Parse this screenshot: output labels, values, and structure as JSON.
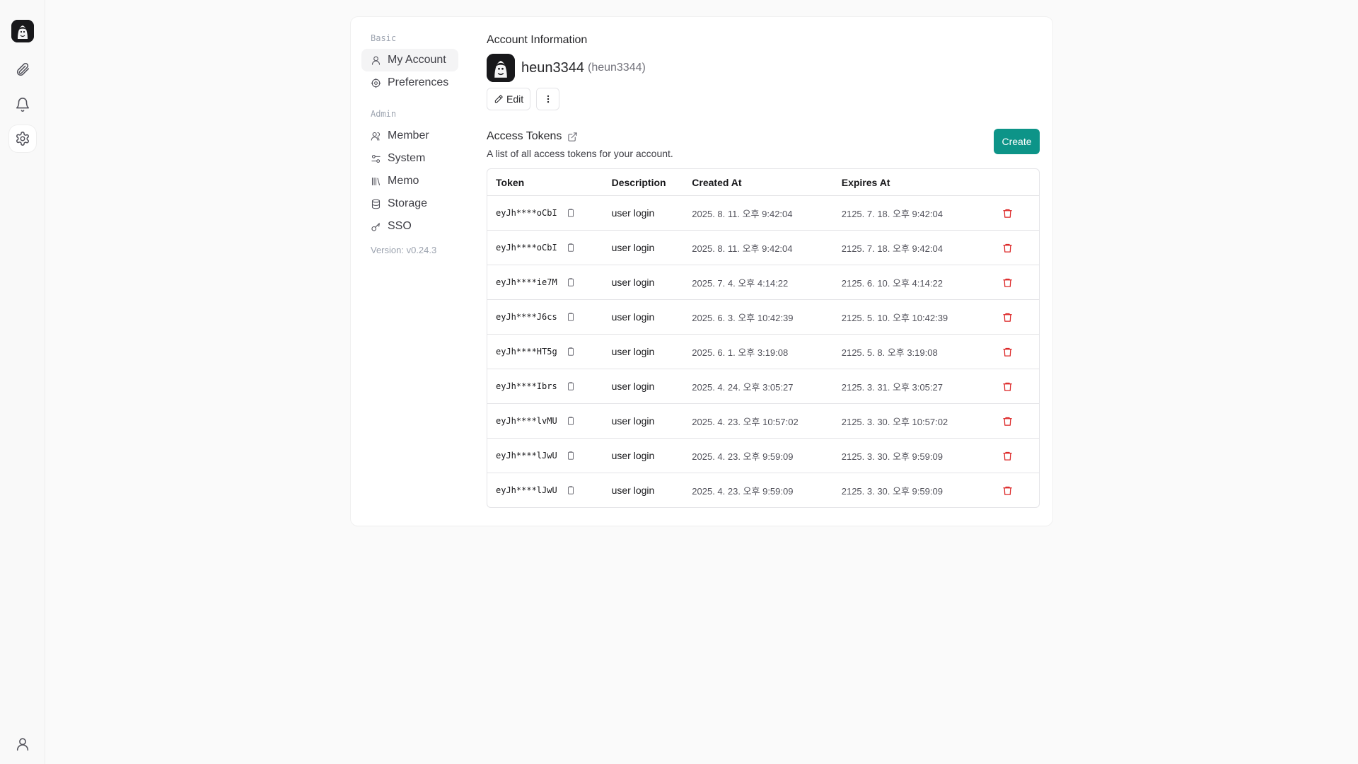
{
  "rail": {
    "icons": [
      "logo",
      "paperclip-icon",
      "bell-icon",
      "settings-icon",
      "user-icon"
    ]
  },
  "settings_nav": {
    "basic_heading": "Basic",
    "basic_items": [
      {
        "label": "My Account",
        "icon": "user-icon",
        "active": true
      },
      {
        "label": "Preferences",
        "icon": "gear-icon",
        "active": false
      }
    ],
    "admin_heading": "Admin",
    "admin_items": [
      {
        "label": "Member",
        "icon": "users-icon"
      },
      {
        "label": "System",
        "icon": "sliders-icon"
      },
      {
        "label": "Memo",
        "icon": "library-icon"
      },
      {
        "label": "Storage",
        "icon": "database-icon"
      },
      {
        "label": "SSO",
        "icon": "key-icon"
      }
    ],
    "version": "Version: v0.24.3"
  },
  "account": {
    "section_title": "Account Information",
    "username": "heun3344",
    "nickname": "(heun3344)",
    "edit_label": "Edit"
  },
  "tokens": {
    "title": "Access Tokens",
    "description": "A list of all access tokens for your account.",
    "create_label": "Create",
    "columns": [
      "Token",
      "Description",
      "Created At",
      "Expires At"
    ],
    "rows": [
      {
        "token": "eyJh****oCbI",
        "description": "user login",
        "created": "2025. 8. 11. 오후 9:42:04",
        "expires": "2125. 7. 18. 오후 9:42:04"
      },
      {
        "token": "eyJh****oCbI",
        "description": "user login",
        "created": "2025. 8. 11. 오후 9:42:04",
        "expires": "2125. 7. 18. 오후 9:42:04"
      },
      {
        "token": "eyJh****ie7M",
        "description": "user login",
        "created": "2025. 7. 4. 오후 4:14:22",
        "expires": "2125. 6. 10. 오후 4:14:22"
      },
      {
        "token": "eyJh****J6cs",
        "description": "user login",
        "created": "2025. 6. 3. 오후 10:42:39",
        "expires": "2125. 5. 10. 오후 10:42:39"
      },
      {
        "token": "eyJh****HT5g",
        "description": "user login",
        "created": "2025. 6. 1. 오후 3:19:08",
        "expires": "2125. 5. 8. 오후 3:19:08"
      },
      {
        "token": "eyJh****Ibrs",
        "description": "user login",
        "created": "2025. 4. 24. 오후 3:05:27",
        "expires": "2125. 3. 31. 오후 3:05:27"
      },
      {
        "token": "eyJh****lvMU",
        "description": "user login",
        "created": "2025. 4. 23. 오후 10:57:02",
        "expires": "2125. 3. 30. 오후 10:57:02"
      },
      {
        "token": "eyJh****lJwU",
        "description": "user login",
        "created": "2025. 4. 23. 오후 9:59:09",
        "expires": "2125. 3. 30. 오후 9:59:09"
      },
      {
        "token": "eyJh****lJwU",
        "description": "user login",
        "created": "2025. 4. 23. 오후 9:59:09",
        "expires": "2125. 3. 30. 오후 9:59:09"
      }
    ]
  },
  "colors": {
    "accent": "#0d9488",
    "danger": "#dc2626"
  }
}
